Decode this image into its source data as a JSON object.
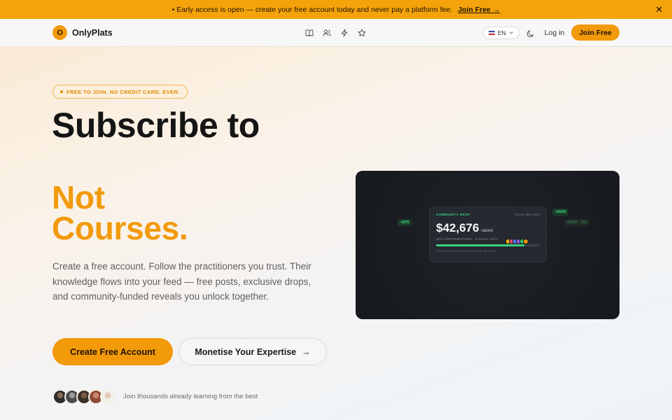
{
  "announcement": {
    "text": "• Early access is open — create your free account today and never pay a platform fee.",
    "link": "Join Free →",
    "close": "✕"
  },
  "nav": {
    "brand_mark": "O",
    "brand_name": "OnlyPlats",
    "icons": [
      "book-icon",
      "users-icon",
      "bolt-icon",
      "star-icon"
    ],
    "language": "EN",
    "login": "Log in",
    "join": "Join Free"
  },
  "hero": {
    "badge": "FREE TO JOIN. NO CREDIT CARD. EVER.",
    "headline_1": "Subscribe to",
    "headline_2a": "Not",
    "headline_2b": "Courses.",
    "lede": "Create a free account. Follow the practitioners you trust. Their knowledge flows into your feed — free posts, exclusive drops, and community-funded reveals you unlock together.",
    "cta_primary": "Create Free Account",
    "cta_secondary": "Monetise Your Expertise",
    "cta_secondary_arrow": "→",
    "social_proof": "Join thousands already learning from the best"
  },
  "preview": {
    "card_label": "COMMUNITY DROP",
    "goal": "GOAL $50,000",
    "amount": "$42,676",
    "raised_label": "raised",
    "meta": "493 CONTRIBUTORS · 6 DAYS LEFT",
    "progress": 0.85,
    "unlock_note": "UNLOCKS FOR EVERYONE AT $50,000",
    "chips": [
      "+$75",
      "+$100",
      "+$250 · 18s"
    ]
  },
  "colors": {
    "accent": "#f29a0a",
    "banner": "#f5a30b",
    "success": "#3ddc84",
    "dark_card": "#1a1d22"
  }
}
